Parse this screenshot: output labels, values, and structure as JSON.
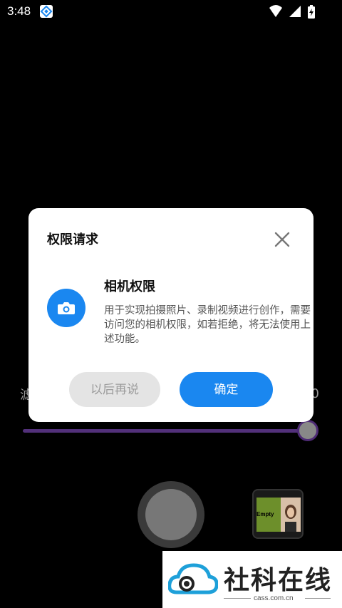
{
  "status_bar": {
    "time": "3:48",
    "icons": [
      "app-badge-icon",
      "wifi-icon",
      "signal-icon",
      "battery-charging-icon"
    ]
  },
  "camera": {
    "slider_left_label": "滤",
    "slider_right_label": "0",
    "slider_value_fraction": 1.0,
    "gallery_thumbnail_text": "Empty"
  },
  "dialog": {
    "title": "权限请求",
    "close_icon": "close-icon",
    "permission_icon": "camera-icon",
    "permission_title": "相机权限",
    "permission_description": "用于实现拍摄照片、录制视频进行创作，需要访问您的相机权限，如若拒绝，将无法使用上述功能。",
    "later_button": "以后再说",
    "confirm_button": "确定",
    "accent_color": "#1a87f0"
  },
  "watermark": {
    "title": "社科在线",
    "subtitle": "cass.com.cn"
  }
}
